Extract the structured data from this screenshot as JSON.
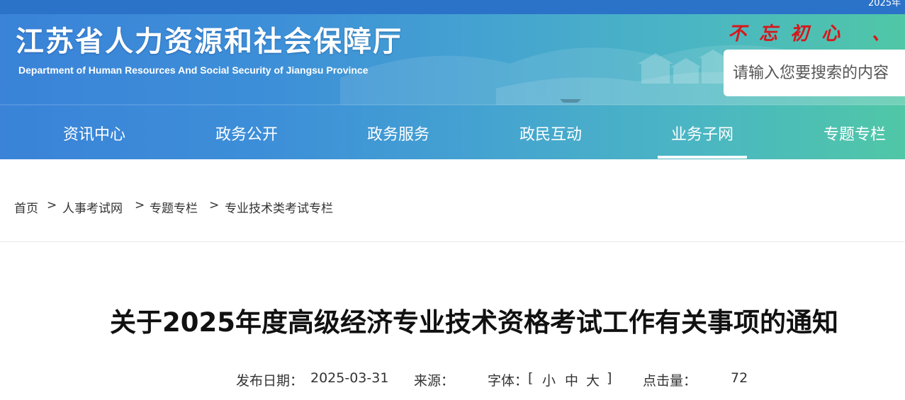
{
  "top_bar": {
    "date": "2025年"
  },
  "header": {
    "title": "江苏省人力资源和社会保障厅",
    "subtitle": "Department of Human Resources And Social Security of Jiangsu Province",
    "slogan": "不忘初心  、",
    "search": {
      "placeholder": "请输入您要搜索的内容"
    }
  },
  "nav": {
    "items": [
      {
        "label": "资讯中心"
      },
      {
        "label": "政务公开"
      },
      {
        "label": "政务服务"
      },
      {
        "label": "政民互动"
      },
      {
        "label": "业务子网",
        "active": true
      },
      {
        "label": "专题专栏"
      }
    ]
  },
  "breadcrumb": {
    "prefix": "：",
    "items": [
      "首页",
      "人事考试网",
      "专题专栏",
      "专业技术类考试专栏"
    ],
    "separator": ">"
  },
  "article": {
    "title": "关于2025年度高级经济专业技术资格考试工作有关事项的通知",
    "meta": {
      "publish_label": "发布日期：",
      "publish_date": "2025-03-31",
      "source_label": "来源：",
      "source_value": "",
      "font_label": "字体：",
      "bracket_open": "[",
      "font_small": "小",
      "font_medium": "中",
      "font_large": "大",
      "bracket_close": "]",
      "views_label": "点击量：",
      "views": "72"
    }
  },
  "colors": {
    "slogan_red": "#d8161b",
    "header_blue": "#3a83d8",
    "header_green": "#50c7a6"
  }
}
